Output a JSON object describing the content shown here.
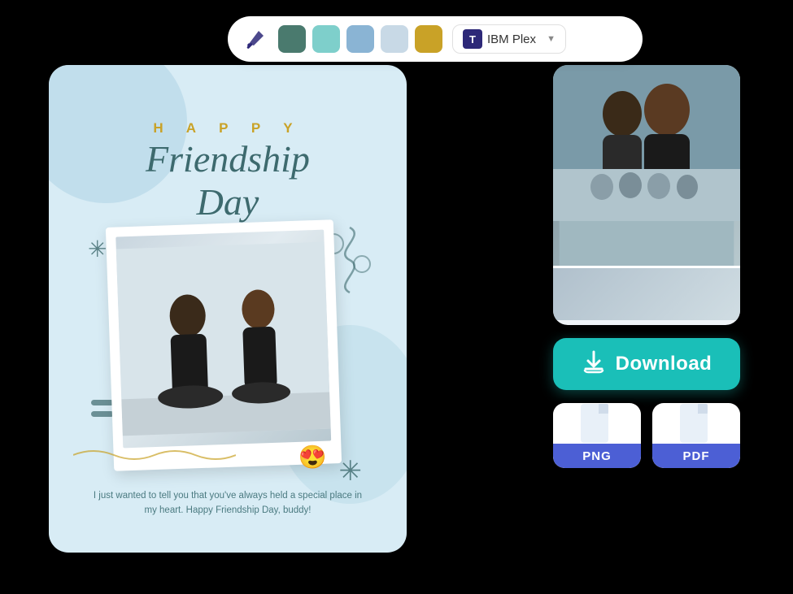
{
  "toolbar": {
    "paint_icon_label": "paint-bucket",
    "swatches": [
      {
        "color": "#4a7a6e",
        "name": "dark-green"
      },
      {
        "color": "#7ecfcb",
        "name": "teal"
      },
      {
        "color": "#8ab4d4",
        "name": "blue"
      },
      {
        "color": "#c8d9e6",
        "name": "light-blue"
      },
      {
        "color": "#c9a227",
        "name": "gold"
      }
    ],
    "font_label": "IBM Plex",
    "font_t": "T",
    "chevron": "▼"
  },
  "card": {
    "happy_text": "H A P P Y",
    "title_line1": "Friendship",
    "title_line2": "Day",
    "subtitle": "I just wanted to tell you that you've always held a special\nplace in my heart. Happy Friendship Day, buddy!",
    "emoji": "😍"
  },
  "right_panel": {
    "download_label": "Download",
    "png_label": "PNG",
    "pdf_label": "PDF"
  }
}
